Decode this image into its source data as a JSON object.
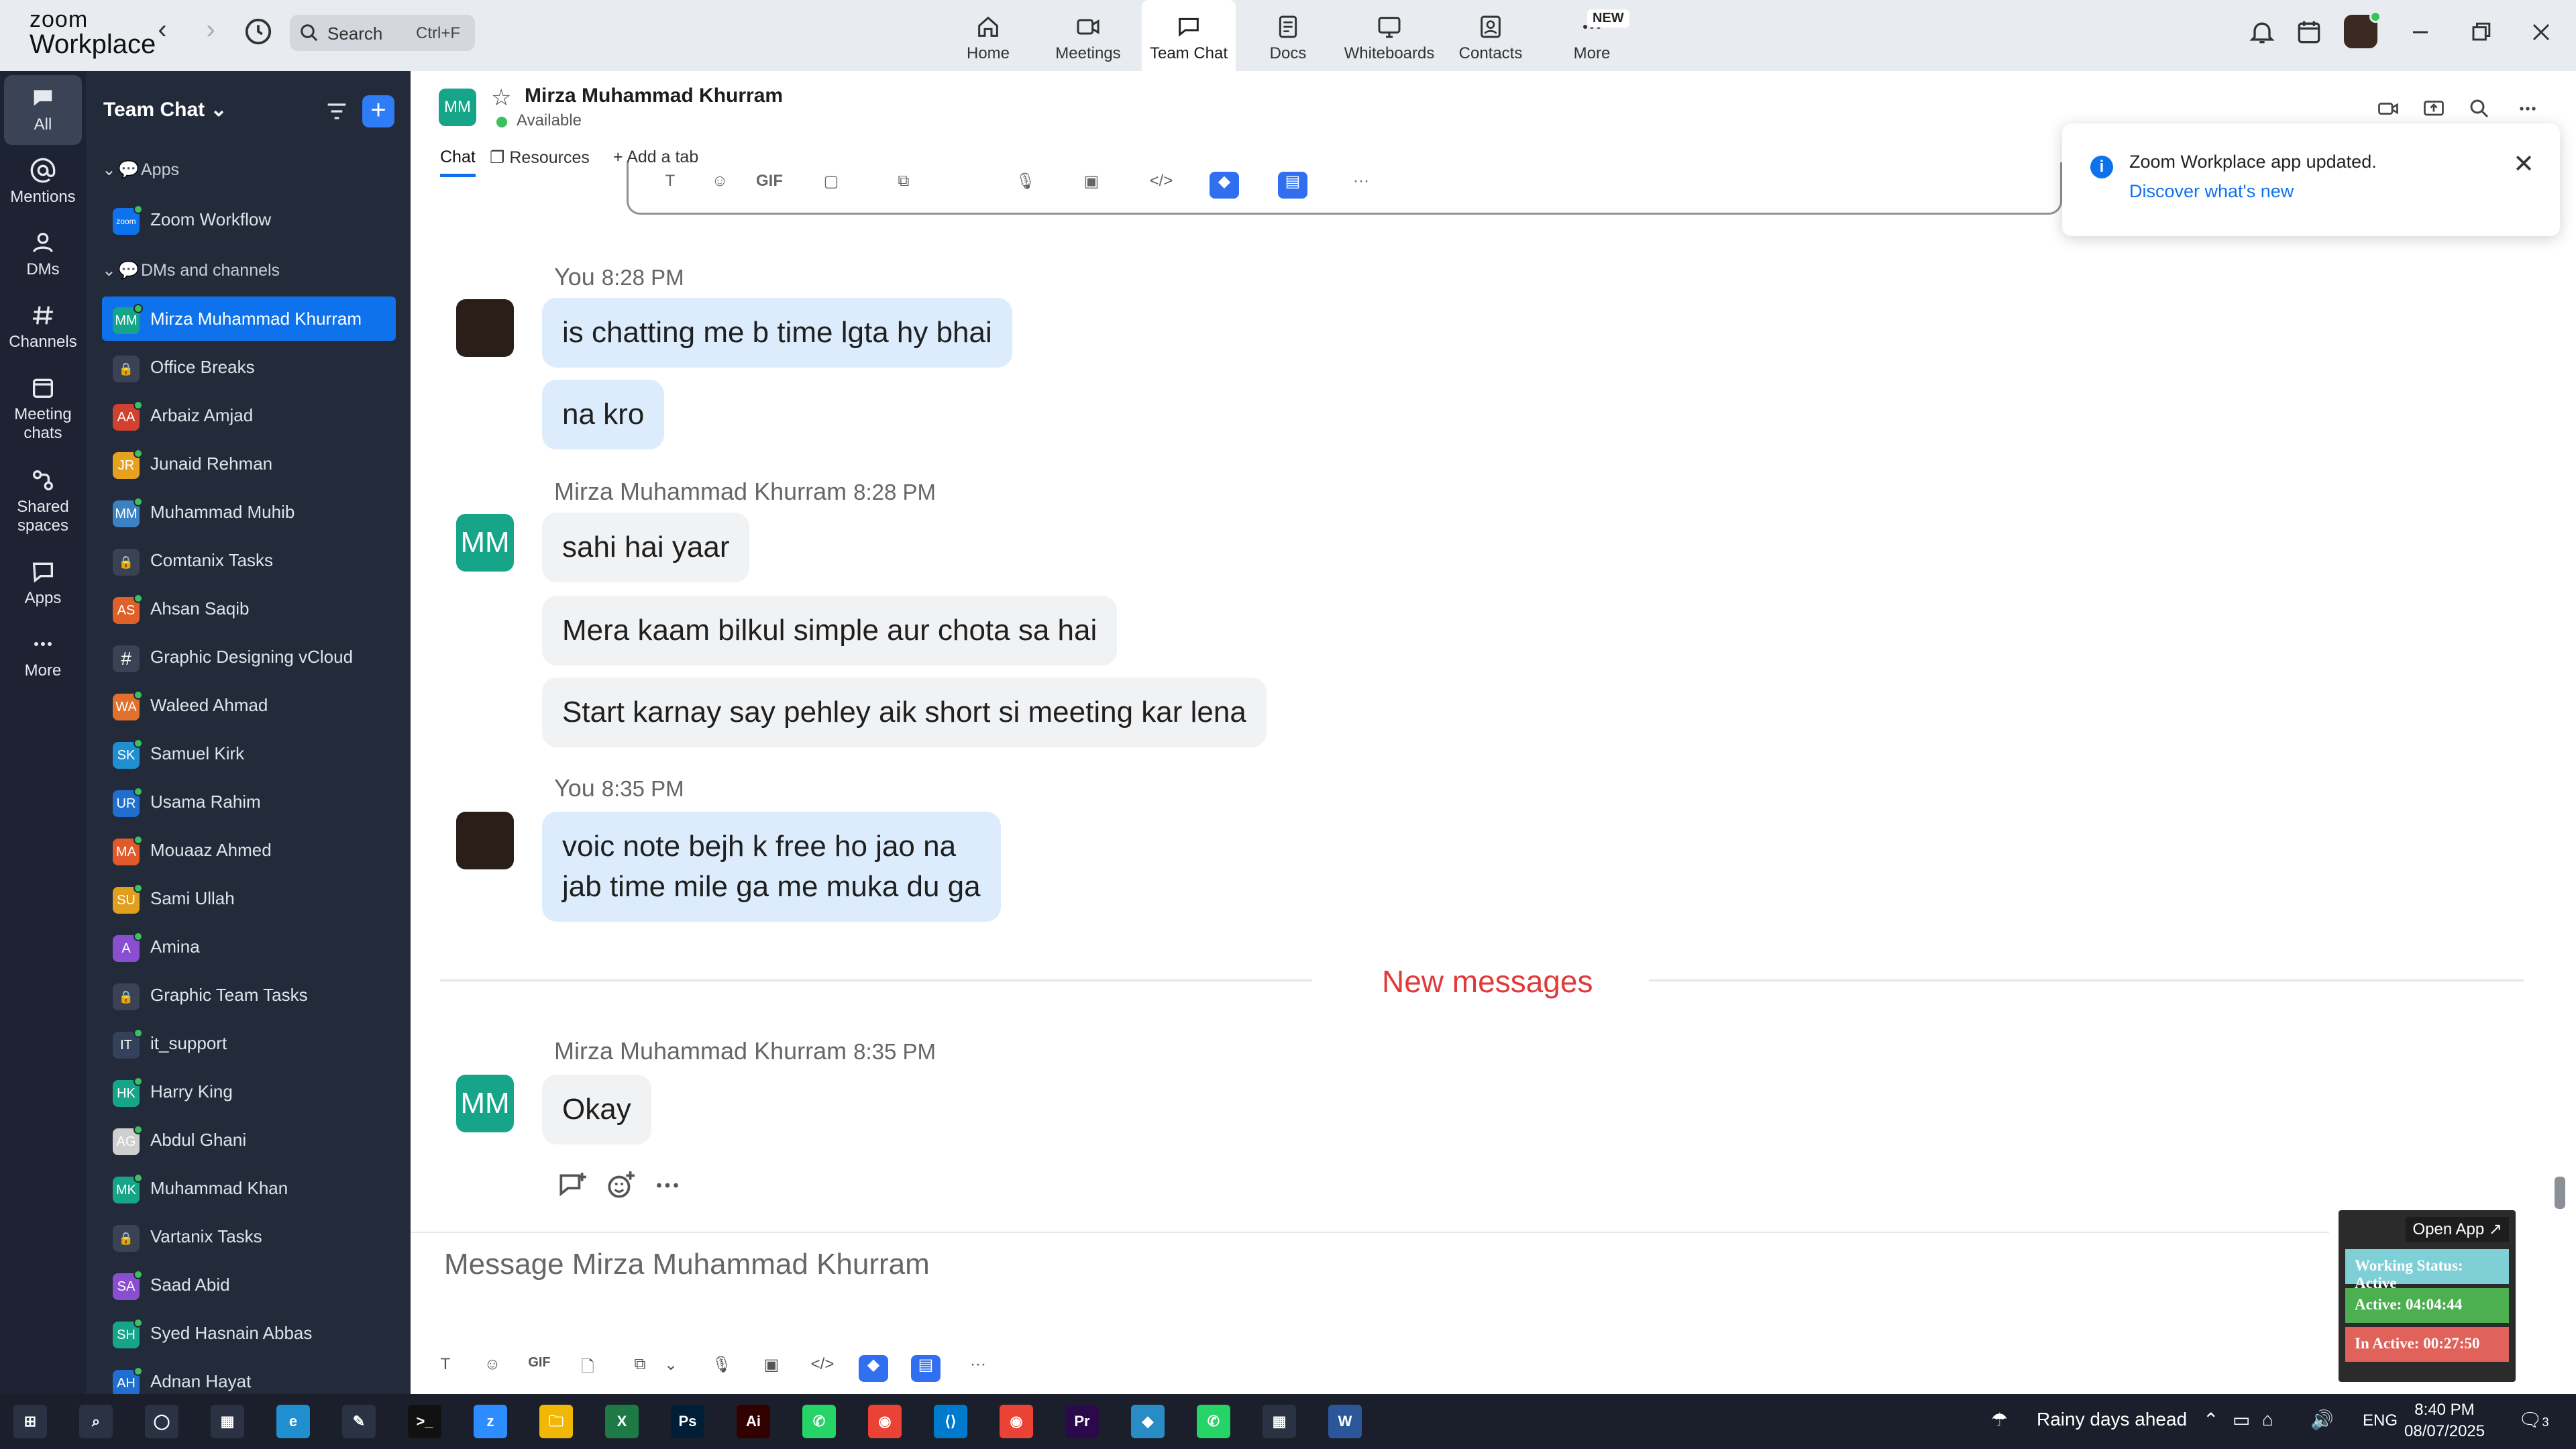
{
  "app": {
    "logo_line1": "zoom",
    "logo_line2": "Workplace"
  },
  "search": {
    "placeholder": "Search",
    "shortcut": "Ctrl+F"
  },
  "top_tabs": [
    {
      "label": "Home",
      "icon": "home-icon"
    },
    {
      "label": "Meetings",
      "icon": "camera-icon"
    },
    {
      "label": "Team Chat",
      "icon": "chat-icon"
    },
    {
      "label": "Docs",
      "icon": "doc-icon"
    },
    {
      "label": "Whiteboards",
      "icon": "whiteboard-icon"
    },
    {
      "label": "Contacts",
      "icon": "contacts-icon"
    },
    {
      "label": "More",
      "icon": "more-icon",
      "badge": "NEW"
    }
  ],
  "rail": [
    {
      "label": "All",
      "icon": "chat-icon"
    },
    {
      "label": "Mentions",
      "icon": "at-icon"
    },
    {
      "label": "DMs",
      "icon": "people-icon"
    },
    {
      "label": "Channels",
      "icon": "hash-icon"
    },
    {
      "label_1": "Meeting",
      "label_2": "chats",
      "icon": "calendar-icon"
    },
    {
      "label_1": "Shared",
      "label_2": "spaces",
      "icon": "share-icon"
    },
    {
      "label": "Apps",
      "icon": "apps-icon"
    },
    {
      "label": "More",
      "icon": "ellipsis-icon"
    }
  ],
  "sidebar": {
    "title": "Team Chat",
    "sections": {
      "apps": "Apps",
      "dms": "DMs and channels"
    },
    "app_item": {
      "name": "Zoom Workflow",
      "badge": "zoom"
    },
    "items": [
      {
        "name": "Mirza Muhammad Khurram",
        "initials": "MM",
        "color": "#17a589",
        "active": true
      },
      {
        "name": "Office Breaks",
        "type": "lock"
      },
      {
        "name": "Arbaiz Amjad",
        "initials": "AA",
        "color": "#d0412f"
      },
      {
        "name": "Junaid Rehman",
        "initials": "JR",
        "color": "#e6a21e"
      },
      {
        "name": "Muhammad Muhib",
        "initials": "MM",
        "color": "#3b82c4"
      },
      {
        "name": "Comtanix Tasks",
        "type": "lock"
      },
      {
        "name": "Ahsan Saqib",
        "initials": "AS",
        "color": "#e0602a"
      },
      {
        "name": "Graphic Designing vCloud",
        "type": "hash"
      },
      {
        "name": "Waleed Ahmad",
        "initials": "WA",
        "color": "#e0702a"
      },
      {
        "name": "Samuel Kirk",
        "initials": "SK",
        "color": "#1f8fd0"
      },
      {
        "name": "Usama Rahim",
        "initials": "UR",
        "color": "#1f6fd0"
      },
      {
        "name": "Mouaaz Ahmed",
        "initials": "MA",
        "color": "#e05a2a"
      },
      {
        "name": "Sami Ullah",
        "initials": "SU",
        "color": "#e0a01e"
      },
      {
        "name": "Amina",
        "initials": "A",
        "color": "#8a4fd0"
      },
      {
        "name": "Graphic Team Tasks",
        "type": "lock"
      },
      {
        "name": "it_support",
        "initials": "IT",
        "color": "#33415a"
      },
      {
        "name": "Harry King",
        "initials": "HK",
        "color": "#17a589"
      },
      {
        "name": "Abdul Ghani",
        "initials": "AG",
        "color": "#cfcfcf"
      },
      {
        "name": "Muhammad Khan",
        "initials": "MK",
        "color": "#17a589"
      },
      {
        "name": "Vartanix Tasks",
        "type": "lock"
      },
      {
        "name": "Saad Abid",
        "initials": "SA",
        "color": "#8a4fd0"
      },
      {
        "name": "Syed Hasnain Abbas",
        "initials": "SH",
        "color": "#17a589"
      },
      {
        "name": "Adnan Hayat",
        "initials": "AH",
        "color": "#1f6fd0"
      }
    ]
  },
  "channel": {
    "initials": "MM",
    "name": "Mirza Muhammad Khurram",
    "status": "Available",
    "tabs": {
      "chat": "Chat",
      "resources": "Resources",
      "add": "Add a tab"
    }
  },
  "toast": {
    "title": "Zoom Workplace app updated.",
    "link": "Discover what's new"
  },
  "messages": {
    "g1": {
      "sender": "You",
      "time": "8:28 PM",
      "m1": "is chatting me b time lgta hy bhai",
      "m2": "na kro"
    },
    "g2": {
      "sender": "Mirza Muhammad Khurram",
      "time": "8:28 PM",
      "m1": "sahi hai yaar",
      "m2": "Mera kaam bilkul simple aur chota sa hai",
      "m3": "Start karnay say pehley aik short si meeting kar lena"
    },
    "g3": {
      "sender": "You",
      "time": "8:35 PM",
      "m1": "voic note bejh k free ho jao na",
      "m2": "jab time mile ga me muka du ga"
    },
    "divider": "New messages",
    "g4": {
      "sender": "Mirza Muhammad Khurram",
      "time": "8:35 PM",
      "m1": "Okay"
    }
  },
  "composer": {
    "placeholder": "Message Mirza Muhammad Khurram"
  },
  "widget": {
    "open": "Open App ↗",
    "working": "Working Status: Active",
    "active": "Active: 04:04:44",
    "inactive": "In Active: 00:27:50",
    "colors": {
      "working": "#7fd0d6",
      "active": "#4caf50",
      "inactive": "#e0625b"
    }
  },
  "taskbar": {
    "weather": "Rainy days ahead",
    "lang": "ENG",
    "time": "8:40 PM",
    "date": "08/07/2025",
    "notif_count": "3",
    "apps": [
      "start-icon",
      "search-icon",
      "cortana-icon",
      "taskview-icon",
      "edge-icon",
      "pen-icon",
      "terminal-icon",
      "zoom-icon",
      "explorer-icon",
      "excel-icon",
      "photoshop-icon",
      "illustrator-icon",
      "whatsapp-icon",
      "chrome-icon",
      "vscode-icon",
      "chrome-alt-icon",
      "premiere-icon",
      "app-icon",
      "whatsapp-alt-icon",
      "calculator-icon",
      "word-icon"
    ]
  }
}
